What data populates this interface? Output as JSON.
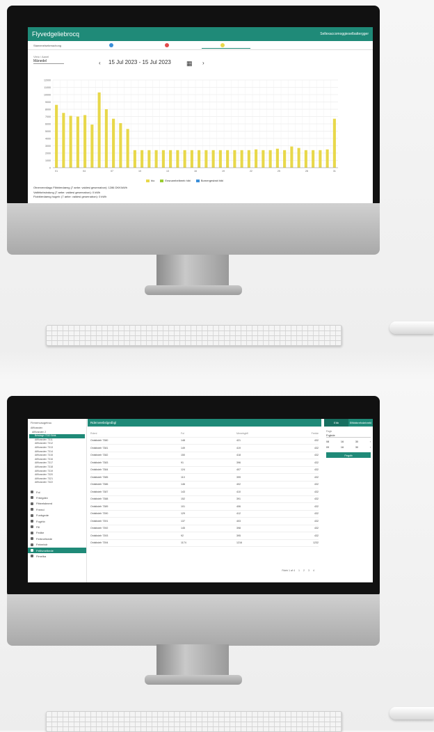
{
  "monitor1": {
    "app_title": "Flyvedgeliebrocq",
    "header_link": "Sellexaccomoggieselbattergger",
    "steps_label": "Stamenelsebreachong",
    "step_colors": [
      "#3b8fd9",
      "#e24a4a",
      "#e8d84a"
    ],
    "select_label": "Vleio / Aanel",
    "select_value": "Mánedel",
    "nav_prev": "‹",
    "nav_next": "›",
    "date_range": "15 Jul 2023 - 15 Jul 2023",
    "calendar_icon": "calendar-icon",
    "legend": [
      {
        "label": "hio",
        "color": "#e8d84a"
      },
      {
        "label": "Ensnarebelbeeb hibi",
        "color": "#9acd32"
      },
      {
        "label": "Bornergesbstt hibi",
        "color": "#3b8fd9"
      }
    ],
    "summary": [
      "Otnervennilagu Flibbierdaeng (7 aebe: valdesi gesernabon): 1286 DKK/kWh",
      "Valtbforbsindung (7 aebe: valdesi gesernabon): 0 kWh",
      "Flobbierdaeng hugeb: (7 aebe: valdesi gesernabon): 0 kWh"
    ]
  },
  "chart_data": {
    "type": "bar",
    "title": "",
    "xlabel": "",
    "ylabel": "",
    "ylim": [
      0,
      12
    ],
    "y_ticks": [
      "0",
      "1000",
      "2000",
      "3000",
      "4000",
      "5000",
      "6000",
      "7000",
      "8000",
      "9000",
      "10000",
      "11000",
      "12000"
    ],
    "x_ticks": [
      "01",
      "04",
      "07",
      "10",
      "13",
      "16",
      "19",
      "22",
      "25",
      "28",
      "31"
    ],
    "grid": true,
    "legend_position": "bottom",
    "series": [
      {
        "name": "hio",
        "color": "#e8d84a",
        "values": [
          8.6,
          7.5,
          7.1,
          7.0,
          7.2,
          5.9,
          10.3,
          8.0,
          6.7,
          6.1,
          5.3,
          2.4,
          2.4,
          2.4,
          2.4,
          2.4,
          2.4,
          2.4,
          2.4,
          2.4,
          2.4,
          2.4,
          2.4,
          2.4,
          2.4,
          2.4,
          2.4,
          2.4,
          2.5,
          2.4,
          2.4,
          2.6,
          2.4,
          2.9,
          2.7,
          2.4,
          2.4,
          2.4,
          2.5,
          6.7
        ]
      }
    ]
  },
  "monitor2": {
    "sidebar_heading": "Firmenvaugetruu",
    "tree_top": [
      "Afifivanden",
      "Afifivanden 2"
    ],
    "tree_items": [
      "Brtwlagn 7310 Brbk",
      "Afifivanden 7311",
      "Afifivanden 7312",
      "Afifivanden 7313",
      "Afifivanden 7314",
      "Afifivanden 7315",
      "Afifivanden 7316",
      "Afifivanden 7317",
      "Afifivanden 7318",
      "Afifivanden 7319",
      "Afifivanden 7320",
      "Afifivanden 7321",
      "Afifivanden 7322"
    ],
    "menu_items": [
      "Fol",
      "Frbegdev",
      "Fitteelsbnerd",
      "Fremd",
      "Funbgede",
      "Fogrhb",
      "Fill",
      "Fedbe",
      "Ferbnellvede",
      "Febrebdr",
      "Fellbvnelbede",
      "Fimelba"
    ],
    "active_menu_index": 10,
    "topbar_title": "Rdenveebslgedbgl",
    "table_headers": [
      "Rdenl",
      "Fol",
      "Menebgbfl",
      "Fretde"
    ],
    "table_rows": [
      [
        "Onlstbdelr 7380",
        "148",
        "421",
        "432"
      ],
      [
        "Onlstbdelr 7381",
        "149",
        "419",
        "432"
      ],
      [
        "Onlstbdelr 7382",
        "150",
        "418",
        "432"
      ],
      [
        "Onlstbdelr 7383",
        "91",
        "396",
        "432"
      ],
      [
        "Onlstbdelr 7384",
        "124",
        "407",
        "432"
      ],
      [
        "Onlstbdelr 7385",
        "110",
        "399",
        "432"
      ],
      [
        "Onlstbdelr 7386",
        "146",
        "402",
        "432"
      ],
      [
        "Onlstbdelr 7387",
        "143",
        "410",
        "432"
      ],
      [
        "Onlstbdelr 7388",
        "152",
        "391",
        "432"
      ],
      [
        "Onlstbdelr 7389",
        "101",
        "406",
        "432"
      ],
      [
        "Onlstbdelr 7390",
        "129",
        "412",
        "432"
      ],
      [
        "Onlstbdelr 7391",
        "137",
        "403",
        "432"
      ],
      [
        "Onlstbdelr 7392",
        "145",
        "398",
        "432"
      ],
      [
        "Onlstbdelr 7393",
        "92",
        "395",
        "432"
      ],
      [
        "Onlstbdelr 7394",
        "1174",
        "1216",
        "1232"
      ]
    ],
    "pager_text": "Rdeb 1 af 4",
    "pager_pages": [
      "1",
      "2",
      "3",
      "4"
    ],
    "panel_tabs": [
      "Eltb",
      "Eftbbbrefvdebrebl"
    ],
    "panel_field_label": "Fegb",
    "panel_field_value": "Frgbde",
    "panel_time_rows": [
      [
        "08",
        "16",
        "30",
        "›"
      ],
      [
        "09",
        "16",
        "30",
        "›"
      ]
    ],
    "panel_button": "Fegdb"
  }
}
